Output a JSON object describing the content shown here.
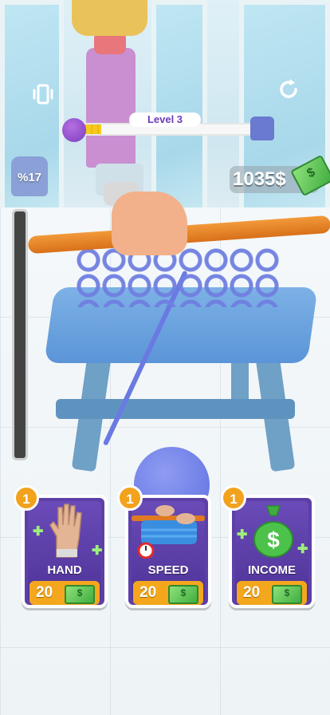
{
  "hud": {
    "vibration_icon": "vibration-icon",
    "restart_icon": "restart-icon",
    "level_label": "Level 3",
    "level_progress": 0.12,
    "completion_percent": "%17",
    "money": "1035$"
  },
  "upgrades": [
    {
      "level": "1",
      "title": "HAND",
      "price": "20",
      "icon": "hand-icon"
    },
    {
      "level": "1",
      "title": "SPEED",
      "price": "20",
      "icon": "speed-icon"
    },
    {
      "level": "1",
      "title": "INCOME",
      "price": "20",
      "icon": "money-bag-icon"
    }
  ],
  "colors": {
    "card_bg": "#5d3fa8",
    "price_bar": "#f4a71c",
    "badge": "#f2a21c",
    "yarn": "#6f7fe0",
    "needle": "#e07a22",
    "level_text": "#6b3bb8"
  }
}
